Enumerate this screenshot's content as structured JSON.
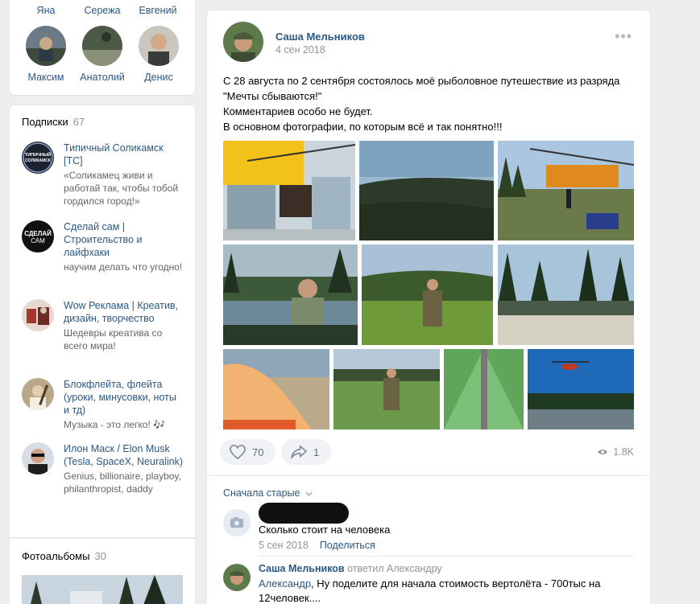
{
  "friends": {
    "top_names": [
      "Яна",
      "Сережа",
      "Евгений"
    ],
    "items": [
      {
        "name": "Максим"
      },
      {
        "name": "Анатолий"
      },
      {
        "name": "Денис"
      }
    ]
  },
  "subscriptions": {
    "title": "Подписки",
    "count": "67",
    "items": [
      {
        "name": "Типичный Соликамск [ТС]",
        "desc": "«Соликамец живи и работай так, чтобы тобой гордился город!»",
        "avatar_text": "ТИПИЧНЫЙ СОЛИКАМСК"
      },
      {
        "name": "Сделай сам | Строительство и лайфхаки",
        "desc": "научим делать что угодно!",
        "avatar_text": "СДЕЛАЙ САМ"
      },
      {
        "name": "Wow Реклама | Креатив, дизайн, творчество",
        "desc": "Шедевры креатива со всего мира!"
      },
      {
        "name": "Блокфлейта, флейта (уроки, минусовки, ноты и тд)",
        "desc": "Музыка - это легко! 🎶"
      },
      {
        "name": "Илон Маск / Elon Musk (Tesla, SpaceX, Neuralink)",
        "desc": "Genius, billionaire, playboy, philanthropist, daddy"
      }
    ]
  },
  "albums": {
    "title": "Фотоальбомы",
    "count": "30"
  },
  "post": {
    "author": "Саша Мельников",
    "date": "4 сен 2018",
    "more": "•••",
    "text_lines": [
      "С 28 августа по 2 сентября состоялось моё рыболовное путешествие из разряда \"Мечты сбываются!\"",
      "Комментариев особо не будет.",
      "В основном фотографии, по которым всё и так понятно!!!"
    ],
    "likes": "70",
    "shares": "1",
    "views": "1.8K"
  },
  "comments": {
    "sort_label": "Сначала старые",
    "items": [
      {
        "text": "Сколько стоит на человека",
        "date": "5 сен 2018",
        "action": "Поделиться"
      },
      {
        "name": "Саша Мельников",
        "replied": "ответил Александру",
        "addressee": "Александру",
        "reply_to": "Александр",
        "text_rest": ", Ну поделите для начала стоимость вертолёта - 700тыс на 12человек...."
      }
    ]
  },
  "colors": {
    "link": "#2a5885",
    "muted": "#939393",
    "background": "#edeef0"
  }
}
